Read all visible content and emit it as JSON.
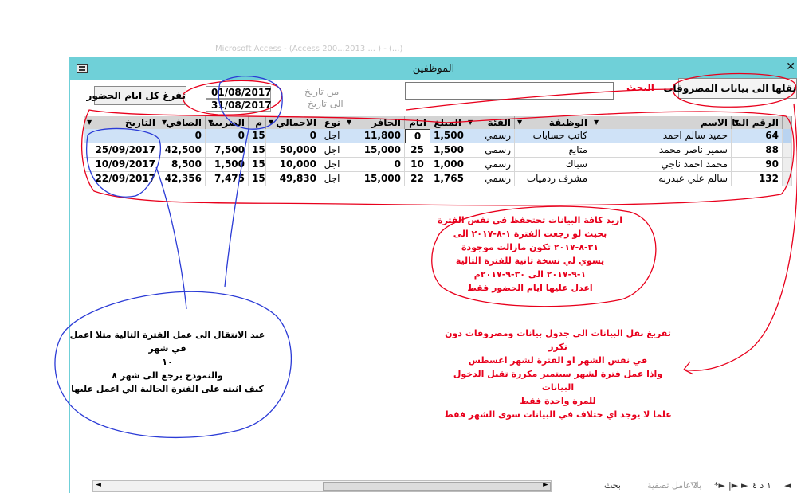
{
  "app": {
    "blurred_title": "Microsoft Access - (Access 200...2013 ... ) - (...)",
    "window_title": "الموظفين"
  },
  "toolbar": {
    "clear_button": "تفرغ كل ايام الحضور",
    "move_button": "نقلها الى بيانات المصروفات",
    "search_label": "البحث",
    "from_label": "من تاريخ",
    "to_label": "الى تاريخ",
    "from_date": "01/08/2017",
    "to_date": "31/08/2017"
  },
  "table": {
    "headers": [
      "الرقم الما",
      "الاسم",
      "الوظيفة",
      "الفئة",
      "المبلغ",
      "ايام",
      "الحافز",
      "نوع",
      "الاجمالي",
      "م",
      "الضريبة",
      "الصافي",
      "التاريخ"
    ],
    "rows": [
      [
        "64",
        "حميد سالم احمد",
        "كاتب حسابات",
        "رسمي",
        "1,500",
        "0",
        "11,800",
        "اجل",
        "0",
        "15",
        "0",
        "0",
        ""
      ],
      [
        "88",
        "سمير ناصر محمد",
        "متابع",
        "رسمي",
        "1,500",
        "25",
        "15,000",
        "اجل",
        "50,000",
        "15",
        "7,500",
        "42,500",
        "25/09/2017"
      ],
      [
        "90",
        "محمد احمد ناجي",
        "سباك",
        "رسمي",
        "1,000",
        "10",
        "0",
        "اجل",
        "10,000",
        "15",
        "1,500",
        "8,500",
        "10/09/2017"
      ],
      [
        "132",
        "سالم علي عبدربه",
        "مشرف ردميات",
        "رسمي",
        "1,765",
        "22",
        "15,000",
        "اجل",
        "49,830",
        "15",
        "7,475",
        "42,356",
        "22/09/2017"
      ]
    ]
  },
  "annotations": {
    "note1": [
      "اريد كافة البيانات تحتحفظ في نفس الفترة",
      "بحيث لو رجعت الفترة ١-٨-٢٠١٧ الى",
      "٣١-٨-٢٠١٧ تكون مازالت موجودة",
      "يسوي لي نسخة ثانية للفترة التالية",
      "١-٩-٢٠١٧ الى ٣٠-٩-٢٠١٧م",
      "اعدل عليها ايام الحضور فقط"
    ],
    "note2": [
      "تفريغ نقل البيانات الى جدول بيانات ومصروفات دون تكرر",
      "في نفس الشهر او الفترة لشهر اغسطس",
      "واذا عمل فترة لشهر سبتمبر مكررة تقبل الدخول البيانات",
      "للمرة واحدة فقط",
      "علما لا يوجد اي ختلاف في البيانات سوى الشهر فقط"
    ],
    "note3": [
      "عند الانتقال الى عمل الفترة التالية مثلا اعمل في شهر",
      "١٠",
      "والنموذج يرجع الى شهر ٨",
      "كيف اثبته على الفترة الحالية الي اعمل عليها"
    ]
  },
  "navigation": {
    "record_indicator": "١ د ٤",
    "filter_label": "بلا عامل تصفية",
    "search_label": "بحث"
  },
  "colors": {
    "titlebar": "#6fd0d8",
    "annotation_red": "#e8001c",
    "annotation_blue": "#2b3bd6"
  }
}
